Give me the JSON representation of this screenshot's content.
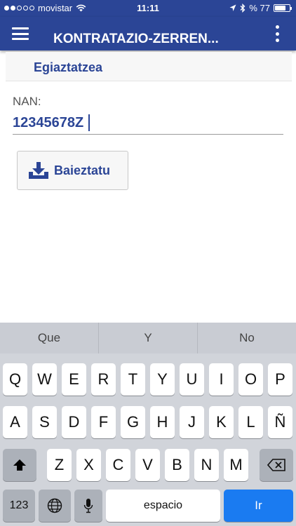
{
  "status_bar": {
    "carrier": "movistar",
    "time": "11:11",
    "battery_label": "% 77",
    "battery_level": 0.77
  },
  "app_bar": {
    "title": "KONTRATAZIO-ZERREN...",
    "menu_icon": "hamburger-menu-icon",
    "overflow_icon": "overflow-menu-icon"
  },
  "section": {
    "title": "Egiaztatzea"
  },
  "form": {
    "nan_label": "NAN:",
    "nan_value": "12345678Z",
    "confirm_label": "Baieztatu",
    "confirm_icon": "download-icon"
  },
  "keyboard": {
    "suggestions": [
      "Que",
      "Y",
      "No"
    ],
    "row1": [
      "Q",
      "W",
      "E",
      "R",
      "T",
      "Y",
      "U",
      "I",
      "O",
      "P"
    ],
    "row2": [
      "A",
      "S",
      "D",
      "F",
      "G",
      "H",
      "J",
      "K",
      "L",
      "Ñ"
    ],
    "row3": [
      "Z",
      "X",
      "C",
      "V",
      "B",
      "N",
      "M"
    ],
    "numbers_label": "123",
    "space_label": "espacio",
    "go_label": "Ir"
  },
  "colors": {
    "brand": "#2b4596",
    "go_key": "#1a7bf1",
    "keyboard_bg": "#d1d4da"
  }
}
